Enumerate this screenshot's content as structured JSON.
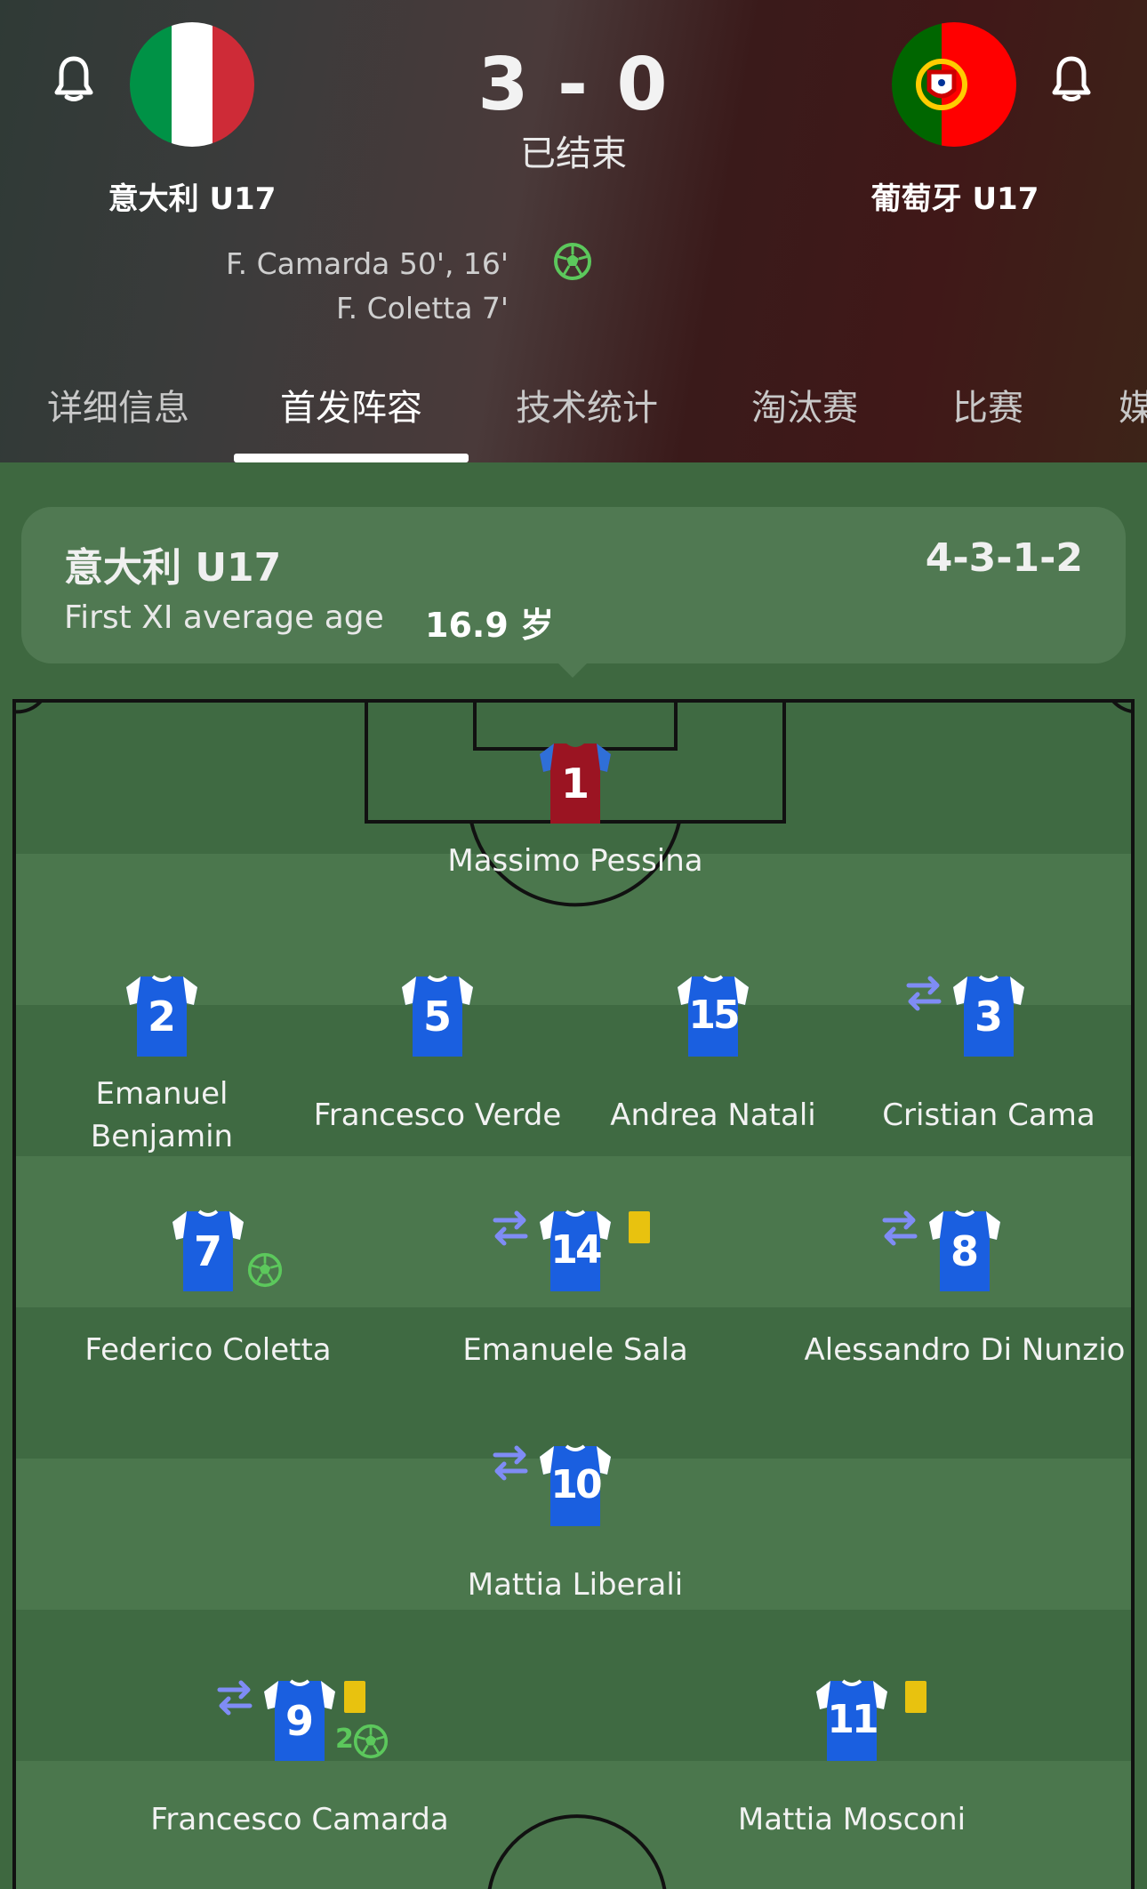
{
  "match": {
    "home_team": "意大利 U17",
    "away_team": "葡萄牙 U17",
    "score": "3 - 0",
    "status": "已结束",
    "scorers": [
      "F. Camarda 50', 16'",
      "F. Coletta 7'"
    ]
  },
  "tabs": [
    "详细信息",
    "首发阵容",
    "技术统计",
    "淘汰赛",
    "比赛",
    "媒"
  ],
  "active_tab": "首发阵容",
  "lineup": {
    "team": "意大利 U17",
    "formation": "4-3-1-2",
    "avg_age_label": "First XI average age",
    "avg_age_value": "16.9 岁"
  },
  "players": [
    {
      "number": "1",
      "name": "Massimo Pessina",
      "role": "goalkeeper"
    },
    {
      "number": "2",
      "name": "Emanuel Benjamin"
    },
    {
      "number": "5",
      "name": "Francesco Verde"
    },
    {
      "number": "15",
      "name": "Andrea Natali"
    },
    {
      "number": "3",
      "name": "Cristian Cama",
      "substituted": true
    },
    {
      "number": "7",
      "name": "Federico Coletta",
      "goals": 1
    },
    {
      "number": "14",
      "name": "Emanuele Sala",
      "substituted": true,
      "yellow_card": true
    },
    {
      "number": "8",
      "name": "Alessandro Di Nunzio",
      "substituted": true
    },
    {
      "number": "10",
      "name": "Mattia Liberali",
      "substituted": true
    },
    {
      "number": "9",
      "name": "Francesco Camarda",
      "substituted": true,
      "yellow_card": true,
      "goals": 2,
      "goal_count_label": "2"
    },
    {
      "number": "11",
      "name": "Mattia Mosconi",
      "yellow_card": true
    }
  ],
  "colors": {
    "home_flag": [
      "#009246",
      "#ffffff",
      "#ce2b37"
    ],
    "kit_primary": "#1a5fe0",
    "kit_collar": "#ffffff",
    "gk_kit": "#9b1422",
    "gk_sleeve": "#2f6fd8",
    "goal_icon": "#5cc85c",
    "sub_icon": "#7f8cf5",
    "yellow_card": "#e8c20f",
    "pitch_light": "#4b774d",
    "pitch_dark": "#3f6a42"
  },
  "icons": [
    "bell-icon",
    "football-icon",
    "substitution-icon",
    "yellow-card-icon"
  ]
}
